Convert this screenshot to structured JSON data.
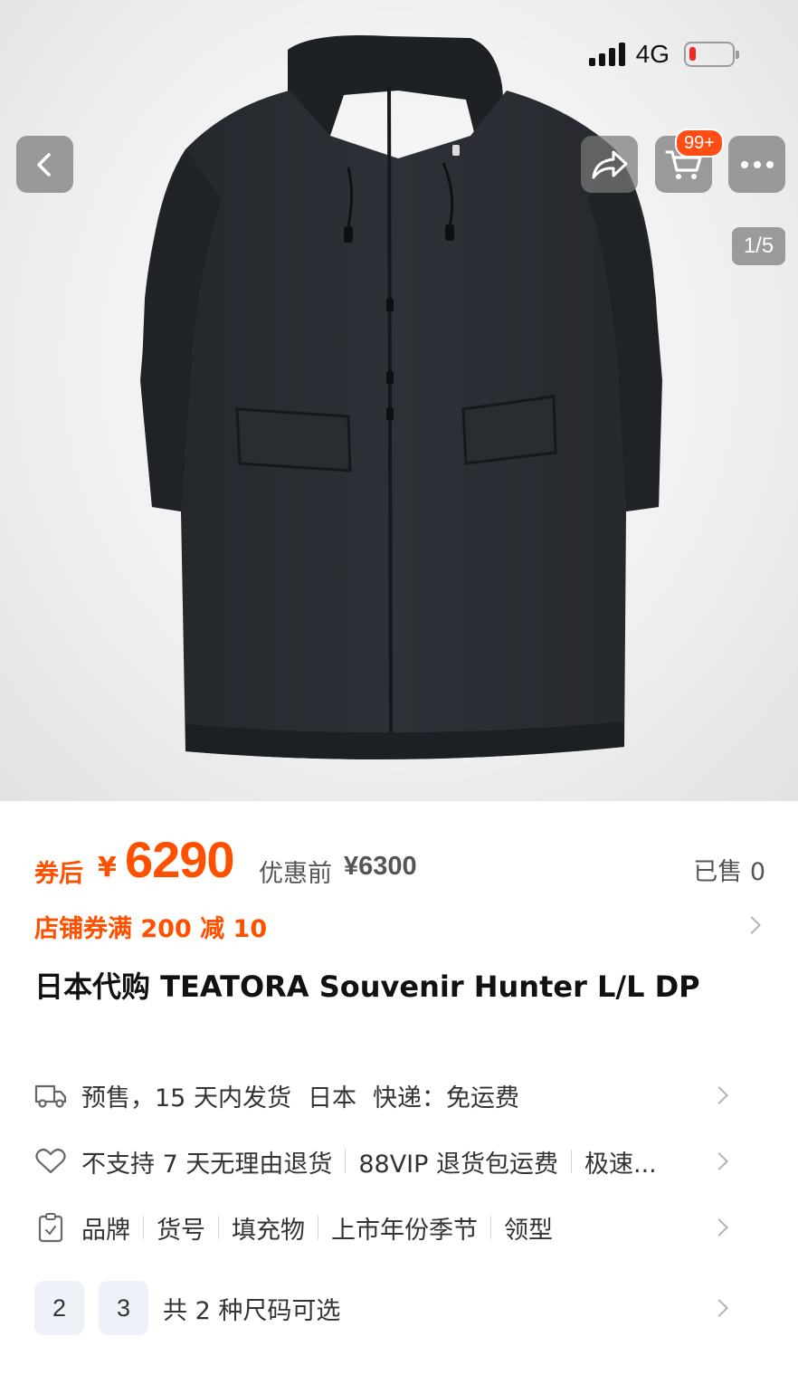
{
  "status_bar": {
    "network": "4G"
  },
  "gallery": {
    "counter": "1/5",
    "cart_badge": "99+"
  },
  "price": {
    "after_label": "券后",
    "currency": "¥",
    "value": "6290",
    "before_label": "优惠前",
    "before_value": "¥6300",
    "sold": "已售 0"
  },
  "coupon": "店铺券满 200 减 10",
  "title": "日本代购 TEATORA  Souvenir Hunter L/L DP",
  "shipping": {
    "presale": "预售，15 天内发货",
    "origin": "日本",
    "express": "快递：免运费"
  },
  "service": {
    "items": [
      "不支持 7 天无理由退货",
      "88VIP 退货包运费",
      "极速..."
    ]
  },
  "params": {
    "items": [
      "品牌",
      "货号",
      "填充物",
      "上市年份季节",
      "领型"
    ]
  },
  "sizes": {
    "options": [
      "2",
      "3"
    ],
    "summary": "共 2 种尺码可选"
  },
  "icons": {
    "back": "chevron-left-icon",
    "share": "share-icon",
    "cart": "cart-icon",
    "more": "more-icon",
    "truck": "truck-icon",
    "heart": "heart-icon",
    "clipboard": "clipboard-icon"
  },
  "colors": {
    "accent": "#ff5000",
    "badge": "#ff4d14",
    "battery_low": "#ee2a24"
  }
}
